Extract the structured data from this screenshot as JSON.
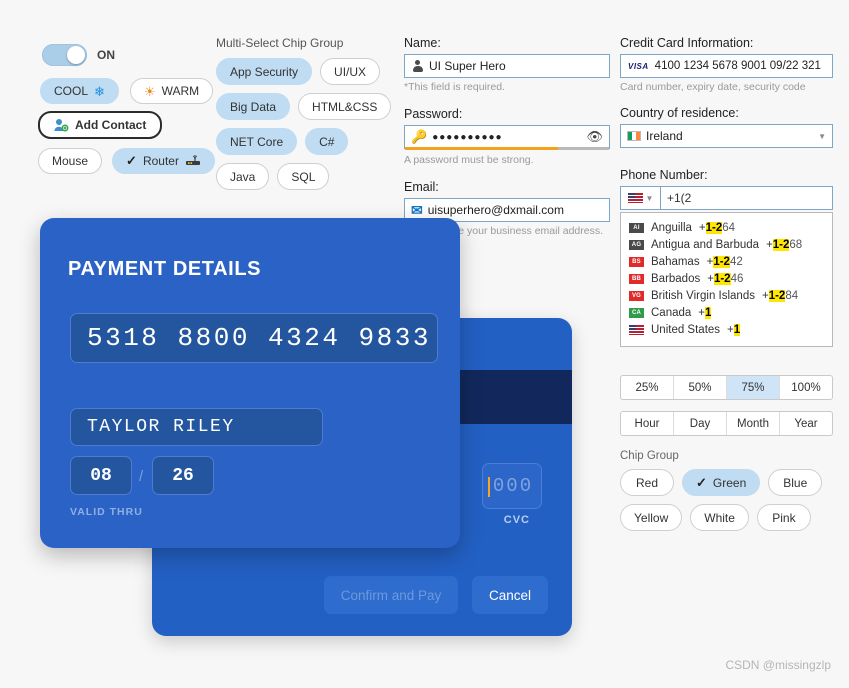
{
  "left_panel": {
    "toggle": {
      "state_label": "ON",
      "checked": true
    },
    "temperature_chips": [
      {
        "label": "COOL",
        "icon": "snowflake-icon",
        "selected": true
      },
      {
        "label": "WARM",
        "icon": "sun-icon",
        "selected": false
      }
    ],
    "add_contact": {
      "label": "Add Contact",
      "icon": "add-user-icon"
    },
    "device_chips": [
      {
        "label": "Mouse",
        "selected": false
      },
      {
        "label": "Router",
        "selected": true,
        "icon": "router-icon",
        "check": "✓"
      }
    ]
  },
  "multi_select_chip_group": {
    "title": "Multi-Select Chip Group",
    "chips": [
      {
        "label": "App Security",
        "selected": true
      },
      {
        "label": "UI/UX",
        "selected": false
      },
      {
        "label": "Big Data",
        "selected": true
      },
      {
        "label": "HTML&CSS",
        "selected": false
      },
      {
        "label": "NET Core",
        "selected": true
      },
      {
        "label": "C#",
        "selected": true
      },
      {
        "label": "Java",
        "selected": false
      },
      {
        "label": "SQL",
        "selected": false
      }
    ]
  },
  "form": {
    "name": {
      "label": "Name:",
      "value": "UI Super Hero",
      "hint": "*This field is required.",
      "icon": "person-icon"
    },
    "password": {
      "label": "Password:",
      "value": "●●●●●●●●●●",
      "hint": "A password must be strong.",
      "icon": "key-icon",
      "reveal_icon": "eye-icon",
      "strength_percent": 75,
      "strength_color": "#f5a11d"
    },
    "email": {
      "label": "Email:",
      "value": "uisuperhero@dxmail.com",
      "hint": "This must be your business email address.",
      "icon": "at-icon"
    }
  },
  "right_panel": {
    "credit_card": {
      "label": "Credit Card Information:",
      "brand": "VISA",
      "value": "4100 1234 5678 9001   09/22   321",
      "hint": "Card number, expiry date, security code"
    },
    "country": {
      "label": "Country of residence:",
      "value": "Ireland",
      "flag": "flag-ireland-icon",
      "dropdown_icon": "chevron-down-icon"
    },
    "phone": {
      "label": "Phone Number:",
      "value": "+1(2",
      "flag": "flag-united-states-icon",
      "dropdown_icon": "chevron-down-icon",
      "suggestions": [
        {
          "code": "AI",
          "name": "Anguilla",
          "prefix_plus": "+",
          "highlight": "1-2",
          "rest": "64",
          "flag_color": "#4a4a4a"
        },
        {
          "code": "AG",
          "name": "Antigua and Barbuda",
          "prefix_plus": "+",
          "highlight": "1-2",
          "rest": "68",
          "flag_color": "#4a4a4a"
        },
        {
          "code": "BS",
          "name": "Bahamas",
          "prefix_plus": "+",
          "highlight": "1-2",
          "rest": "42",
          "flag_color": "#e02b2b"
        },
        {
          "code": "BB",
          "name": "Barbados",
          "prefix_plus": "+",
          "highlight": "1-2",
          "rest": "46",
          "flag_color": "#e02b2b"
        },
        {
          "code": "VG",
          "name": "British Virgin Islands",
          "prefix_plus": "+",
          "highlight": "1-2",
          "rest": "84",
          "flag_color": "#e02b2b"
        },
        {
          "code": "CA",
          "name": "Canada",
          "prefix_plus": "+",
          "highlight": "1",
          "rest": "",
          "flag_color": "#2e9c4a"
        },
        {
          "code": "US",
          "name": "United States",
          "prefix_plus": "+",
          "highlight": "1",
          "rest": "",
          "flag_color": "#b22234"
        }
      ]
    },
    "percent_segments": [
      {
        "label": "25%",
        "selected": false
      },
      {
        "label": "50%",
        "selected": false
      },
      {
        "label": "75%",
        "selected": true
      },
      {
        "label": "100%",
        "selected": false
      }
    ],
    "period_segments": [
      {
        "label": "Hour",
        "selected": false
      },
      {
        "label": "Day",
        "selected": false
      },
      {
        "label": "Month",
        "selected": false
      },
      {
        "label": "Year",
        "selected": false
      }
    ],
    "chip_group": {
      "title": "Chip Group",
      "chips": [
        {
          "label": "Red",
          "selected": false
        },
        {
          "label": "Green",
          "selected": true,
          "check": "✓"
        },
        {
          "label": "Blue",
          "selected": false
        },
        {
          "label": "Yellow",
          "selected": false
        },
        {
          "label": "White",
          "selected": false
        },
        {
          "label": "Pink",
          "selected": false
        }
      ]
    }
  },
  "payment_card_front": {
    "title": "PAYMENT DETAILS",
    "card_number": "5318 8800 4324 9833",
    "card_holder": "TAYLOR RILEY",
    "expiry_month": "08",
    "expiry_separator": "/",
    "expiry_year": "26",
    "valid_thru_label": "VALID THRU"
  },
  "payment_card_back": {
    "cvc_placeholder": "000",
    "cvc_label": "CVC",
    "confirm_button": "Confirm and Pay",
    "confirm_disabled": true,
    "cancel_button": "Cancel"
  },
  "watermark": "CSDN @missingzlp",
  "colors": {
    "accent_blue": "#2b62c6",
    "chip_selected": "#bfdcf2",
    "highlight_yellow": "#ffe600",
    "strength_orange": "#f5a11d",
    "stripe_dark": "#12285c"
  }
}
